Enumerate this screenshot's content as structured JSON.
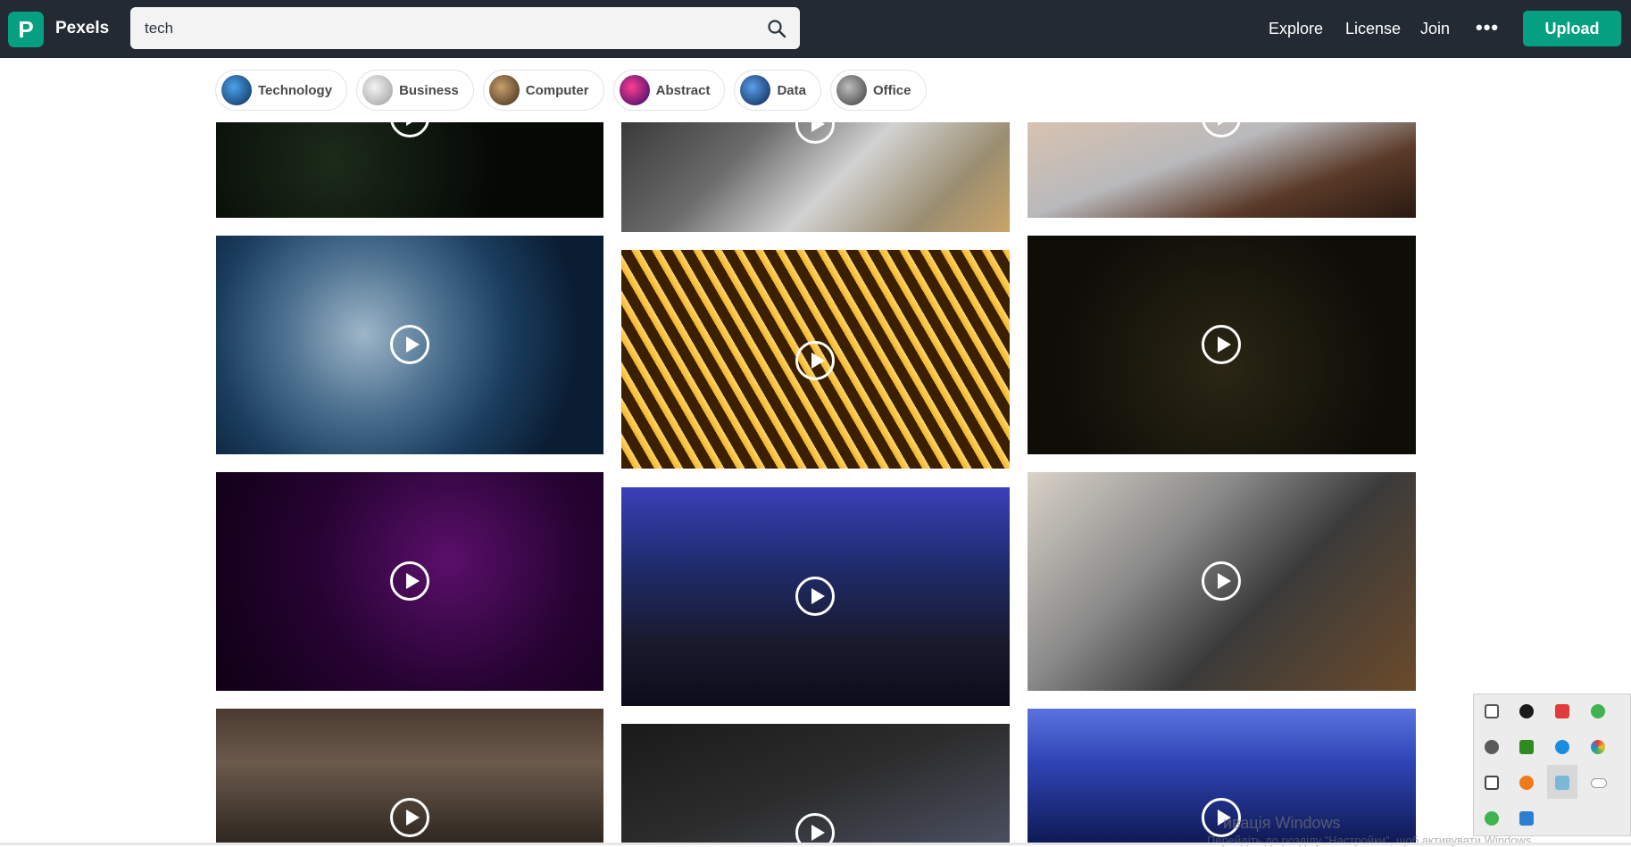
{
  "header": {
    "logo_letter": "P",
    "logo_text": "Pexels",
    "search_value": "tech",
    "nav": [
      "Explore",
      "License",
      "Join"
    ],
    "more_label": "•••",
    "upload_label": "Upload"
  },
  "chips": [
    {
      "label": "Technology",
      "color": "#1d5ea8"
    },
    {
      "label": "Business",
      "color": "#cfcfcf"
    },
    {
      "label": "Computer",
      "color": "#6b4a2a"
    },
    {
      "label": "Abstract",
      "color": "#c2187a"
    },
    {
      "label": "Data",
      "color": "#2a5b9c"
    },
    {
      "label": "Office",
      "color": "#6a6a6a"
    }
  ],
  "watermark": {
    "line1": "ивація Windows",
    "line2": "Перейдіть до розділу \"Настройки\", щоб активувати Windows."
  },
  "accent_color": "#05a081"
}
